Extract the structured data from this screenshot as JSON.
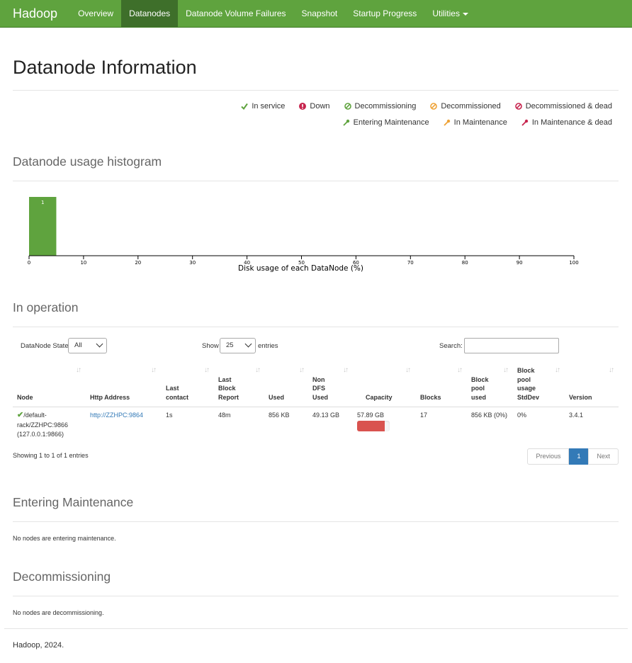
{
  "nav": {
    "brand": "Hadoop",
    "items": [
      {
        "label": "Overview",
        "active": false
      },
      {
        "label": "Datanodes",
        "active": true
      },
      {
        "label": "Datanode Volume Failures",
        "active": false
      },
      {
        "label": "Snapshot",
        "active": false
      },
      {
        "label": "Startup Progress",
        "active": false
      },
      {
        "label": "Utilities",
        "active": false
      }
    ]
  },
  "page_title": "Datanode Information",
  "legend": {
    "row1": [
      {
        "label": "In service",
        "icon": "check-icon",
        "color": "#5fa33e"
      },
      {
        "label": "Down",
        "icon": "exclamation-icon",
        "color": "#c7254e"
      },
      {
        "label": "Decommissioning",
        "icon": "ban-icon",
        "color": "#5fa33e"
      },
      {
        "label": "Decommissioned",
        "icon": "ban-icon",
        "color": "#eea236"
      },
      {
        "label": "Decommissioned & dead",
        "icon": "ban-icon",
        "color": "#c7254e"
      }
    ],
    "row2": [
      {
        "label": "Entering Maintenance",
        "icon": "wrench-icon",
        "color": "#5fa33e"
      },
      {
        "label": "In Maintenance",
        "icon": "wrench-icon",
        "color": "#eea236"
      },
      {
        "label": "In Maintenance & dead",
        "icon": "wrench-icon",
        "color": "#c7254e"
      }
    ]
  },
  "histogram": {
    "heading": "Datanode usage histogram",
    "chart_data": {
      "type": "bar",
      "x": [
        0
      ],
      "bin_width": 5,
      "values": [
        1
      ],
      "data_labels": [
        "1"
      ],
      "xlabel": "Disk usage of each DataNode (%)",
      "xlim": [
        0,
        100
      ],
      "xticks": [
        "0",
        "10",
        "20",
        "30",
        "40",
        "50",
        "60",
        "70",
        "80",
        "90",
        "100"
      ],
      "bar_color": "#5fa33e"
    }
  },
  "operation": {
    "heading": "In operation",
    "state_label": "DataNode State",
    "state_value": "All",
    "show_label": "Show",
    "show_value": "25",
    "entries_label": "entries",
    "search_label": "Search:",
    "columns": [
      [
        "Node"
      ],
      [
        "Http Address"
      ],
      [
        "Last",
        "contact"
      ],
      [
        "Last",
        "Block",
        "Report"
      ],
      [
        "Used"
      ],
      [
        "Non",
        "DFS",
        "Used"
      ],
      [
        "Capacity"
      ],
      [
        "Blocks"
      ],
      [
        "Block",
        "pool",
        "used"
      ],
      [
        "Block",
        "pool",
        "usage",
        "StdDev"
      ],
      [
        "Version"
      ]
    ],
    "row": {
      "node_lines": [
        "/default-",
        "rack/ZZHPC:9866",
        "(127.0.0.1:9866)"
      ],
      "http": "http://ZZHPC:9864",
      "last_contact": "1s",
      "last_block_report": "48m",
      "used": "856 KB",
      "non_dfs_used": "49.13 GB",
      "capacity": "57.89 GB",
      "capacity_used_fraction": 0.85,
      "blocks": "17",
      "block_pool_used": "856 KB (0%)",
      "block_pool_stddev": "0%",
      "version": "3.4.1"
    },
    "info": "Showing 1 to 1 of 1 entries",
    "pager": {
      "previous": "Previous",
      "current": "1",
      "next": "Next"
    }
  },
  "entering": {
    "heading": "Entering Maintenance",
    "message": "No nodes are entering maintenance."
  },
  "decommissioning": {
    "heading": "Decommissioning",
    "message": "No nodes are decommissioning."
  },
  "footer": "Hadoop, 2024."
}
